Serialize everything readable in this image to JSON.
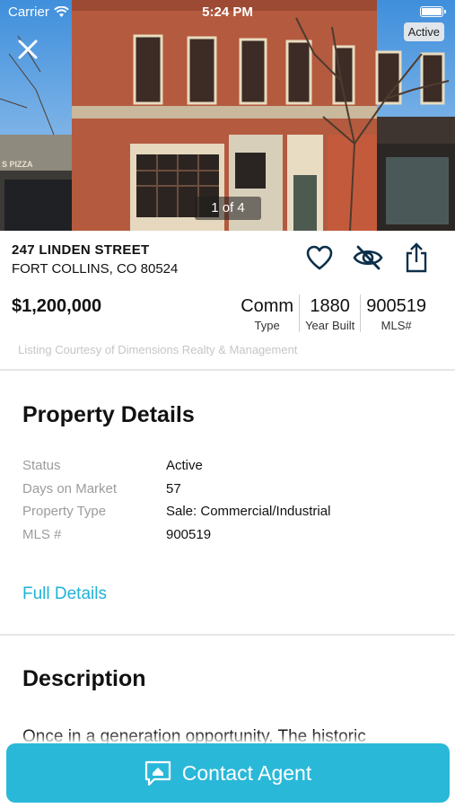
{
  "status_bar": {
    "carrier": "Carrier",
    "time": "5:24 PM"
  },
  "hero": {
    "status_badge": "Active",
    "photo_counter": "1 of 4"
  },
  "listing": {
    "street": "247 LINDEN STREET",
    "city": "FORT COLLINS, CO 80524",
    "price": "$1,200,000",
    "stats": [
      {
        "value": "Comm",
        "label": "Type"
      },
      {
        "value": "1880",
        "label": "Year Built"
      },
      {
        "value": "900519",
        "label": "MLS#"
      }
    ],
    "courtesy": "Listing Courtesy of Dimensions Realty & Management"
  },
  "actions": [
    "heart-icon",
    "hide-eye-icon",
    "share-icon"
  ],
  "property_details": {
    "title": "Property Details",
    "rows": [
      {
        "key": "Status",
        "value": "Active"
      },
      {
        "key": "Days on Market",
        "value": "57"
      },
      {
        "key": "Property Type",
        "value": "Sale: Commercial/Industrial"
      },
      {
        "key": "MLS #",
        "value": "900519"
      }
    ],
    "full_details_link": "Full Details"
  },
  "description": {
    "title": "Description",
    "text": "Once in a generation opportunity. The historic"
  },
  "contact_button": {
    "label": "Contact Agent"
  },
  "colors": {
    "accent": "#2ab8d9",
    "link": "#1fb3d6",
    "icon": "#0c2f4a"
  }
}
